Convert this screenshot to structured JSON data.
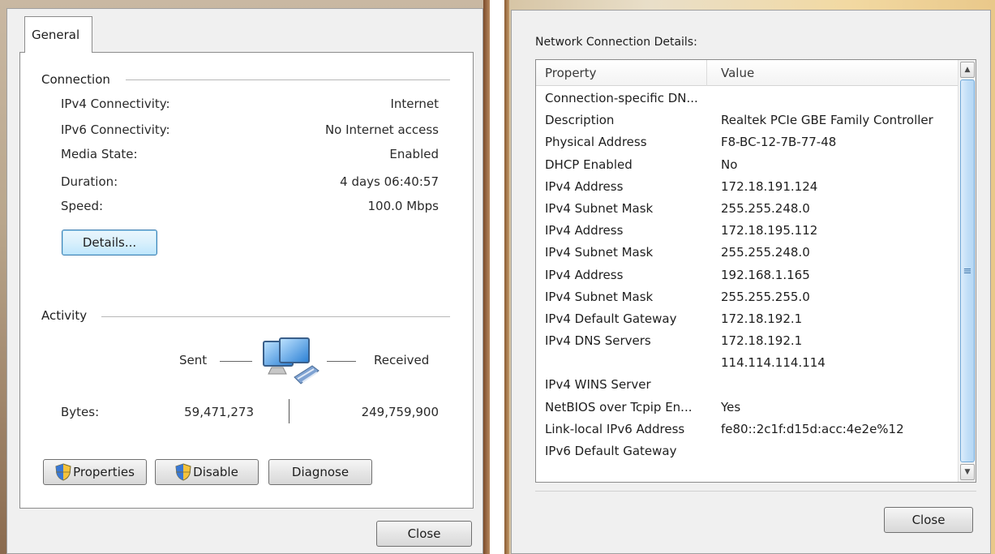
{
  "left_dialog": {
    "tab_label": "General",
    "connection": {
      "title": "Connection",
      "rows": [
        {
          "label": "IPv4 Connectivity:",
          "value": "Internet"
        },
        {
          "label": "IPv6 Connectivity:",
          "value": "No Internet access"
        },
        {
          "label": "Media State:",
          "value": "Enabled"
        },
        {
          "label": "Duration:",
          "value": "4 days 06:40:57"
        },
        {
          "label": "Speed:",
          "value": "100.0 Mbps"
        }
      ],
      "details_button": "Details..."
    },
    "activity": {
      "title": "Activity",
      "sent_label": "Sent",
      "received_label": "Received",
      "bytes_label": "Bytes:",
      "bytes_sent": "59,471,273",
      "bytes_received": "249,759,900"
    },
    "buttons": {
      "properties": "Properties",
      "disable": "Disable",
      "diagnose": "Diagnose",
      "close": "Close"
    }
  },
  "right_dialog": {
    "title": "Network Connection Details:",
    "columns": {
      "property": "Property",
      "value": "Value"
    },
    "rows": [
      {
        "property": "Connection-specific DN...",
        "value": ""
      },
      {
        "property": "Description",
        "value": "Realtek PCIe GBE Family Controller"
      },
      {
        "property": "Physical Address",
        "value": "F8-BC-12-7B-77-48"
      },
      {
        "property": "DHCP Enabled",
        "value": "No"
      },
      {
        "property": "IPv4 Address",
        "value": "172.18.191.124"
      },
      {
        "property": "IPv4 Subnet Mask",
        "value": "255.255.248.0"
      },
      {
        "property": "IPv4 Address",
        "value": "172.18.195.112"
      },
      {
        "property": "IPv4 Subnet Mask",
        "value": "255.255.248.0"
      },
      {
        "property": "IPv4 Address",
        "value": "192.168.1.165"
      },
      {
        "property": "IPv4 Subnet Mask",
        "value": "255.255.255.0"
      },
      {
        "property": "IPv4 Default Gateway",
        "value": "172.18.192.1"
      },
      {
        "property": "IPv4 DNS Servers",
        "value": "172.18.192.1"
      },
      {
        "property": "",
        "value": "114.114.114.114"
      },
      {
        "property": "IPv4 WINS Server",
        "value": ""
      },
      {
        "property": "NetBIOS over Tcpip En...",
        "value": "Yes"
      },
      {
        "property": "Link-local IPv6 Address",
        "value": "fe80::2c1f:d15d:acc:4e2e%12"
      },
      {
        "property": "IPv6 Default Gateway",
        "value": ""
      }
    ],
    "close_button": "Close"
  },
  "colors": {
    "dialog_bg": "#f0f0f0",
    "focus_border": "#3c7fb1",
    "scroll_thumb": "#c2dff7"
  },
  "icons": [
    "network-computers-icon",
    "uac-shield-icon",
    "scroll-up-icon",
    "scroll-down-icon",
    "scroll-grip-icon"
  ]
}
